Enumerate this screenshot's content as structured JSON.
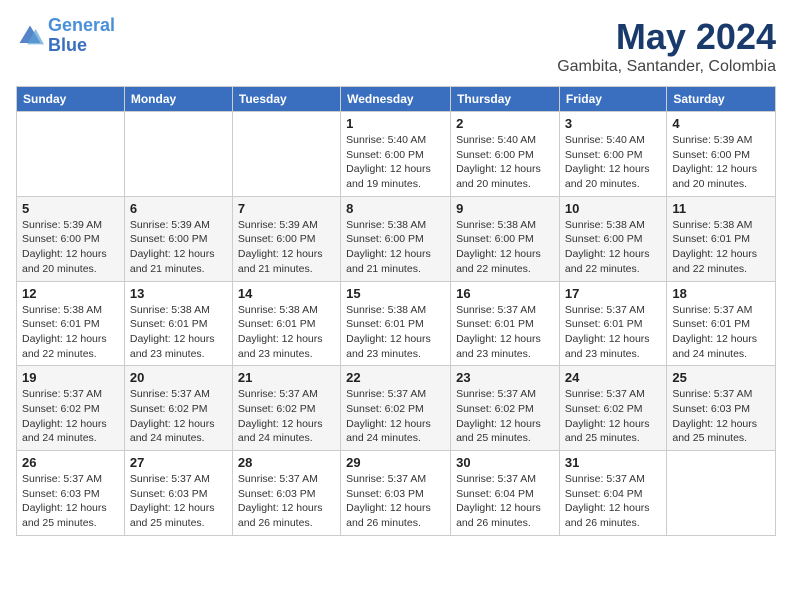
{
  "header": {
    "logo_line1": "General",
    "logo_line2": "Blue",
    "title": "May 2024",
    "subtitle": "Gambita, Santander, Colombia"
  },
  "calendar": {
    "days_of_week": [
      "Sunday",
      "Monday",
      "Tuesday",
      "Wednesday",
      "Thursday",
      "Friday",
      "Saturday"
    ],
    "weeks": [
      [
        {
          "day": "",
          "info": ""
        },
        {
          "day": "",
          "info": ""
        },
        {
          "day": "",
          "info": ""
        },
        {
          "day": "1",
          "info": "Sunrise: 5:40 AM\nSunset: 6:00 PM\nDaylight: 12 hours and 19 minutes."
        },
        {
          "day": "2",
          "info": "Sunrise: 5:40 AM\nSunset: 6:00 PM\nDaylight: 12 hours and 20 minutes."
        },
        {
          "day": "3",
          "info": "Sunrise: 5:40 AM\nSunset: 6:00 PM\nDaylight: 12 hours and 20 minutes."
        },
        {
          "day": "4",
          "info": "Sunrise: 5:39 AM\nSunset: 6:00 PM\nDaylight: 12 hours and 20 minutes."
        }
      ],
      [
        {
          "day": "5",
          "info": "Sunrise: 5:39 AM\nSunset: 6:00 PM\nDaylight: 12 hours and 20 minutes."
        },
        {
          "day": "6",
          "info": "Sunrise: 5:39 AM\nSunset: 6:00 PM\nDaylight: 12 hours and 21 minutes."
        },
        {
          "day": "7",
          "info": "Sunrise: 5:39 AM\nSunset: 6:00 PM\nDaylight: 12 hours and 21 minutes."
        },
        {
          "day": "8",
          "info": "Sunrise: 5:38 AM\nSunset: 6:00 PM\nDaylight: 12 hours and 21 minutes."
        },
        {
          "day": "9",
          "info": "Sunrise: 5:38 AM\nSunset: 6:00 PM\nDaylight: 12 hours and 22 minutes."
        },
        {
          "day": "10",
          "info": "Sunrise: 5:38 AM\nSunset: 6:00 PM\nDaylight: 12 hours and 22 minutes."
        },
        {
          "day": "11",
          "info": "Sunrise: 5:38 AM\nSunset: 6:01 PM\nDaylight: 12 hours and 22 minutes."
        }
      ],
      [
        {
          "day": "12",
          "info": "Sunrise: 5:38 AM\nSunset: 6:01 PM\nDaylight: 12 hours and 22 minutes."
        },
        {
          "day": "13",
          "info": "Sunrise: 5:38 AM\nSunset: 6:01 PM\nDaylight: 12 hours and 23 minutes."
        },
        {
          "day": "14",
          "info": "Sunrise: 5:38 AM\nSunset: 6:01 PM\nDaylight: 12 hours and 23 minutes."
        },
        {
          "day": "15",
          "info": "Sunrise: 5:38 AM\nSunset: 6:01 PM\nDaylight: 12 hours and 23 minutes."
        },
        {
          "day": "16",
          "info": "Sunrise: 5:37 AM\nSunset: 6:01 PM\nDaylight: 12 hours and 23 minutes."
        },
        {
          "day": "17",
          "info": "Sunrise: 5:37 AM\nSunset: 6:01 PM\nDaylight: 12 hours and 23 minutes."
        },
        {
          "day": "18",
          "info": "Sunrise: 5:37 AM\nSunset: 6:01 PM\nDaylight: 12 hours and 24 minutes."
        }
      ],
      [
        {
          "day": "19",
          "info": "Sunrise: 5:37 AM\nSunset: 6:02 PM\nDaylight: 12 hours and 24 minutes."
        },
        {
          "day": "20",
          "info": "Sunrise: 5:37 AM\nSunset: 6:02 PM\nDaylight: 12 hours and 24 minutes."
        },
        {
          "day": "21",
          "info": "Sunrise: 5:37 AM\nSunset: 6:02 PM\nDaylight: 12 hours and 24 minutes."
        },
        {
          "day": "22",
          "info": "Sunrise: 5:37 AM\nSunset: 6:02 PM\nDaylight: 12 hours and 24 minutes."
        },
        {
          "day": "23",
          "info": "Sunrise: 5:37 AM\nSunset: 6:02 PM\nDaylight: 12 hours and 25 minutes."
        },
        {
          "day": "24",
          "info": "Sunrise: 5:37 AM\nSunset: 6:02 PM\nDaylight: 12 hours and 25 minutes."
        },
        {
          "day": "25",
          "info": "Sunrise: 5:37 AM\nSunset: 6:03 PM\nDaylight: 12 hours and 25 minutes."
        }
      ],
      [
        {
          "day": "26",
          "info": "Sunrise: 5:37 AM\nSunset: 6:03 PM\nDaylight: 12 hours and 25 minutes."
        },
        {
          "day": "27",
          "info": "Sunrise: 5:37 AM\nSunset: 6:03 PM\nDaylight: 12 hours and 25 minutes."
        },
        {
          "day": "28",
          "info": "Sunrise: 5:37 AM\nSunset: 6:03 PM\nDaylight: 12 hours and 26 minutes."
        },
        {
          "day": "29",
          "info": "Sunrise: 5:37 AM\nSunset: 6:03 PM\nDaylight: 12 hours and 26 minutes."
        },
        {
          "day": "30",
          "info": "Sunrise: 5:37 AM\nSunset: 6:04 PM\nDaylight: 12 hours and 26 minutes."
        },
        {
          "day": "31",
          "info": "Sunrise: 5:37 AM\nSunset: 6:04 PM\nDaylight: 12 hours and 26 minutes."
        },
        {
          "day": "",
          "info": ""
        }
      ]
    ]
  }
}
